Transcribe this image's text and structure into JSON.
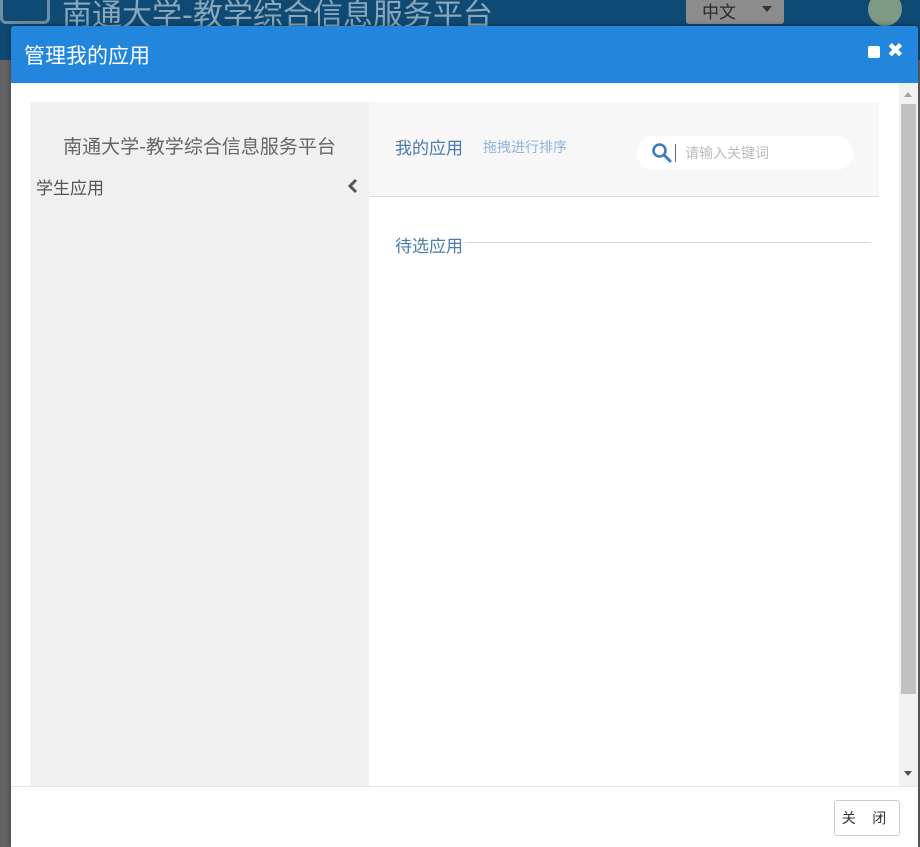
{
  "background": {
    "site_title": "南通大学-教学综合信息服务平台",
    "language": "中文"
  },
  "modal": {
    "title": "管理我的应用",
    "left_panel": {
      "platform_name": "南通大学-教学综合信息服务平台",
      "category": "学生应用"
    },
    "right_panel": {
      "my_apps_label": "我的应用",
      "drag_hint": "拖拽进行排序",
      "search_placeholder": "请输入关键词",
      "pending_label": "待选应用"
    },
    "footer": {
      "close_label": "关 闭"
    }
  },
  "colors": {
    "header_blue": "#2186dc",
    "link_blue": "#4a7bab",
    "hint_blue": "#8cb4dc"
  },
  "icons": {
    "search": "search-icon",
    "collapse": "chevron-left-icon",
    "close": "close-icon",
    "maximize": "maximize-icon"
  }
}
